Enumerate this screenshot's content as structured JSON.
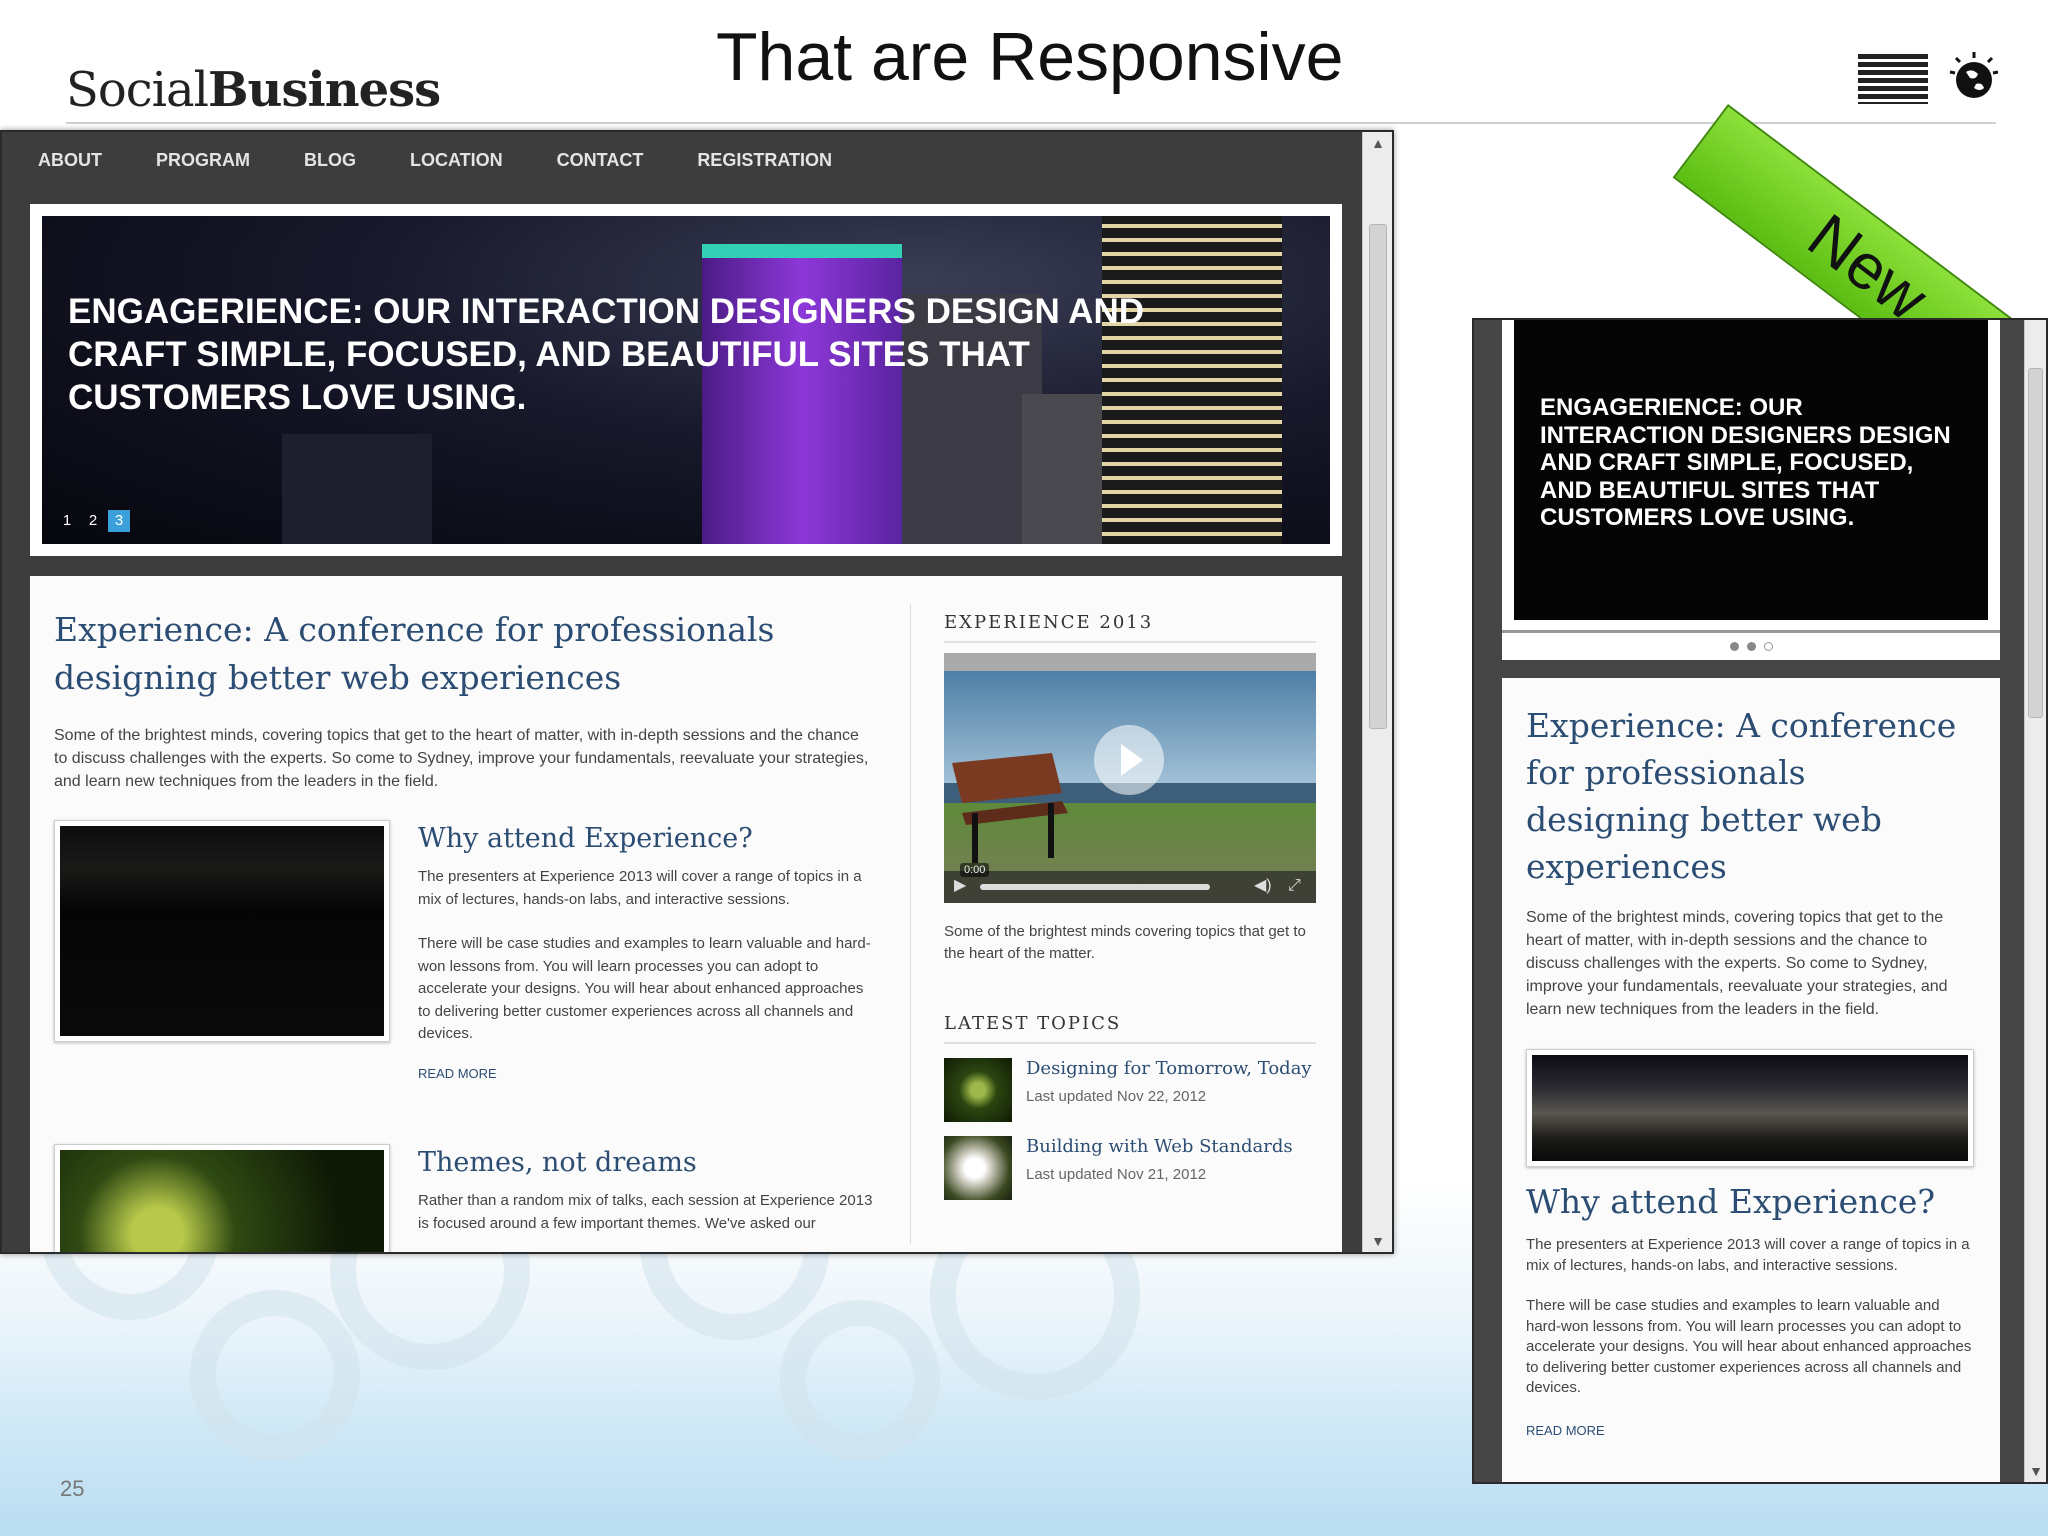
{
  "slide": {
    "brand_light": "Social",
    "brand_bold": "Business",
    "title": "That are Responsive",
    "ribbon": "New",
    "page_number": "25"
  },
  "desktop": {
    "nav": [
      "ABOUT",
      "PROGRAM",
      "BLOG",
      "LOCATION",
      "CONTACT",
      "REGISTRATION"
    ],
    "hero": {
      "text": "ENGAGERIENCE: OUR INTERACTION DESIGNERS DESIGN AND CRAFT SIMPLE, FOCUSED, AND BEAUTIFUL SITES THAT CUSTOMERS LOVE USING.",
      "slides": [
        "1",
        "2",
        "3"
      ],
      "active_slide": "3"
    },
    "main": {
      "heading": "Experience: A conference for professionals designing better web experiences",
      "intro": "Some of the brightest minds, covering topics that get to the heart of matter, with in-depth sessions and the chance to discuss challenges with the experts. So come to Sydney, improve your fundamentals, reevaluate your strategies, and learn new techniques from the leaders in the field.",
      "articles": [
        {
          "title": "Why attend Experience?",
          "p1": "The presenters at Experience 2013 will cover a range of topics in a mix of lectures, hands-on labs, and interactive sessions.",
          "p2": "There will be case studies and examples to learn valuable and hard-won lessons from. You will learn processes you can adopt to accelerate your designs. You will hear about enhanced approaches to delivering better customer experiences across all channels and devices.",
          "read_more": "READ MORE"
        },
        {
          "title": "Themes, not dreams",
          "p1": "Rather than a random mix of talks, each session at Experience 2013 is focused around a few important themes. We've asked our"
        }
      ]
    },
    "sidebar": {
      "video_heading": "EXPERIENCE 2013",
      "video_time": "0:00",
      "video_caption": "Some of the brightest minds covering topics that get to the heart of the matter.",
      "topics_heading": "LATEST TOPICS",
      "topics": [
        {
          "title": "Designing for Tomorrow, Today",
          "date": "Last updated Nov 22, 2012"
        },
        {
          "title": "Building with Web Standards",
          "date": "Last updated Nov 21, 2012"
        }
      ]
    }
  },
  "mobile": {
    "hero_text": "ENGAGERIENCE: OUR INTERACTION DESIGNERS DESIGN AND CRAFT SIMPLE, FOCUSED, AND BEAUTIFUL SITES THAT CUSTOMERS LOVE USING.",
    "heading": "Experience: A conference for professionals designing better web experiences",
    "intro": "Some of the brightest minds, covering topics that get to the heart of matter, with in-depth sessions and the chance to discuss challenges with the experts. So come to Sydney, improve your fundamentals, reevaluate your strategies, and learn new techniques from the leaders in the field.",
    "article_title": "Why attend Experience?",
    "p1": "The presenters at Experience 2013 will cover a range of topics in a mix of lectures, hands-on labs, and interactive sessions.",
    "p2": "There will be case studies and examples to learn valuable and hard-won lessons from. You will learn processes you can adopt to accelerate your designs. You will hear about enhanced approaches to delivering better customer experiences across all channels and devices.",
    "read_more": "READ MORE"
  },
  "colors": {
    "link_blue": "#2c4d73",
    "nav_bg": "#3d3d3d",
    "ribbon_green": "#6fcf1f",
    "active_dot": "#3b9fd9"
  },
  "icons": [
    "ibm-logo",
    "globe-icon",
    "play-icon",
    "volume-icon",
    "fullscreen-icon",
    "scroll-up-arrow",
    "scroll-down-arrow"
  ]
}
